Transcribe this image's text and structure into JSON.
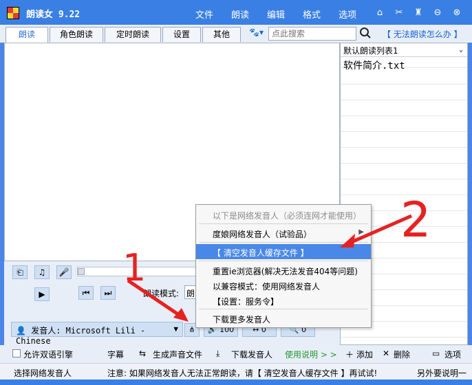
{
  "window": {
    "title": "朗读女 9.22",
    "menu": [
      "文件",
      "朗读",
      "编辑",
      "格式",
      "选项"
    ],
    "controls": [
      "home",
      "settings",
      "theme",
      "minimize",
      "close"
    ]
  },
  "tabs": [
    {
      "label": "朗读",
      "active": true
    },
    {
      "label": "角色朗读",
      "active": false
    },
    {
      "label": "定时朗读",
      "active": false
    },
    {
      "label": "设置",
      "active": false
    },
    {
      "label": "其他",
      "active": false
    }
  ],
  "search": {
    "placeholder": "点此搜索"
  },
  "help_link": "【 无法朗读怎么办 】",
  "playlist": {
    "selected": "默认朗读列表1",
    "items": [
      "软件简介.txt"
    ]
  },
  "player": {
    "read_mode_label": "朗读模式:",
    "read_mode_value": "朗",
    "voice_label": "发音人:",
    "voice_value": "Microsoft Lili - Chinese",
    "volume": "100",
    "speed": "0",
    "pitch": "0"
  },
  "bottom": {
    "bilingual": "允许双语引擎",
    "subtitle": "字幕",
    "generate": "生成声音文件",
    "download": "下载发音人",
    "usage": "使用说明 > >",
    "add": "添加",
    "delete": "删除",
    "options": "选项"
  },
  "status": {
    "left": "选择网络发音人",
    "notice": "注意: 如果网络发音人无法正常朗读，请【 清空发音人缓存文件 】再试试!",
    "right": "另外要说明一"
  },
  "context_menu": {
    "header": "以下是网络发音人（必须连网才能使用）",
    "items": [
      {
        "label": "度娘网络发音人（试验品）",
        "submenu": true
      },
      {
        "label": "【 清空发音人缓存文件 】",
        "highlight": true
      },
      {
        "label": "重置ie浏览器(解决无法发音404等问题)"
      },
      {
        "label": "以兼容模式：使用网络发音人"
      },
      {
        "label": "【设置：服务令】"
      },
      {
        "label": "下载更多发音人"
      }
    ]
  },
  "annotations": {
    "marker_1": "1",
    "marker_2": "2",
    "color": "#e52222"
  }
}
